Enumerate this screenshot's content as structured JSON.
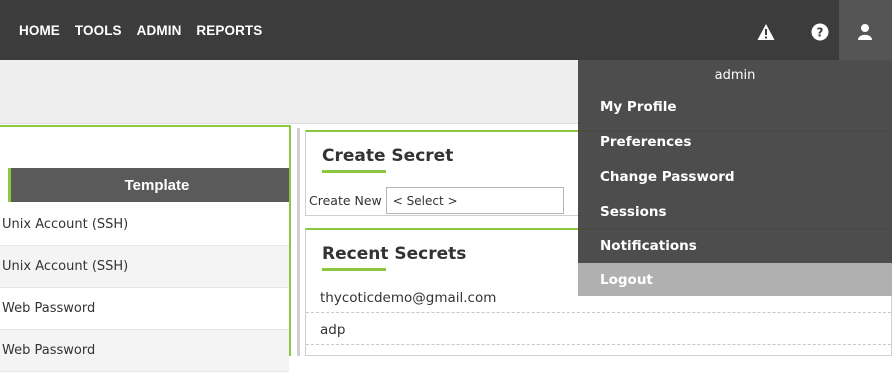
{
  "nav": {
    "items": [
      "HOME",
      "TOOLS",
      "ADMIN",
      "REPORTS"
    ]
  },
  "header_icons": [
    "warning-icon",
    "help-icon",
    "user-icon"
  ],
  "template_panel": {
    "header": "Template",
    "rows": [
      "Unix Account (SSH)",
      "Unix Account (SSH)",
      "Web Password",
      "Web Password"
    ]
  },
  "create_secret": {
    "title": "Create Secret",
    "create_new_label": "Create New",
    "select_value": "< Select >"
  },
  "recent_secrets": {
    "title": "Recent Secrets",
    "items": [
      "thycoticdemo@gmail.com",
      "adp"
    ]
  },
  "user_menu": {
    "username": "admin",
    "items": [
      "My Profile",
      "Preferences",
      "Change Password",
      "Sessions",
      "Notifications",
      "Logout"
    ]
  },
  "colors": {
    "topbar": "#3c3c3c",
    "accent_green": "#8dc63f",
    "dropdown_bg": "#464646",
    "logout_highlight": "#b0b0b0"
  }
}
